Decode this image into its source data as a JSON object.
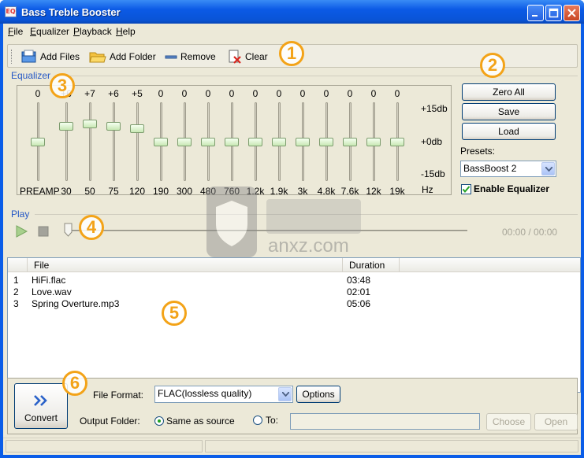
{
  "window": {
    "title": "Bass Treble Booster",
    "icon_text": "EQ"
  },
  "menu": [
    {
      "label": "File",
      "key": "F",
      "rest": "ile"
    },
    {
      "label": "Equalizer",
      "key": "E",
      "rest": "qualizer"
    },
    {
      "label": "Playback",
      "key": "P",
      "rest": "layback"
    },
    {
      "label": "Help",
      "key": "H",
      "rest": "elp"
    }
  ],
  "toolbar": {
    "add_files": "Add Files",
    "add_folder": "Add Folder",
    "remove": "Remove",
    "clear": "Clear"
  },
  "callouts": [
    "1",
    "2",
    "3",
    "4",
    "5",
    "6"
  ],
  "equalizer": {
    "group_label": "Equalizer",
    "bands": [
      {
        "label": "PREAMP",
        "value": "0",
        "level": 0
      },
      {
        "label": "30",
        "value": "+6",
        "level": 6
      },
      {
        "label": "50",
        "value": "+7",
        "level": 7
      },
      {
        "label": "75",
        "value": "+6",
        "level": 6
      },
      {
        "label": "120",
        "value": "+5",
        "level": 5
      },
      {
        "label": "190",
        "value": "0",
        "level": 0
      },
      {
        "label": "300",
        "value": "0",
        "level": 0
      },
      {
        "label": "480",
        "value": "0",
        "level": 0
      },
      {
        "label": "760",
        "value": "0",
        "level": 0
      },
      {
        "label": "1.2k",
        "value": "0",
        "level": 0
      },
      {
        "label": "1.9k",
        "value": "0",
        "level": 0
      },
      {
        "label": "3k",
        "value": "0",
        "level": 0
      },
      {
        "label": "4.8k",
        "value": "0",
        "level": 0
      },
      {
        "label": "7.6k",
        "value": "0",
        "level": 0
      },
      {
        "label": "12k",
        "value": "0",
        "level": 0
      },
      {
        "label": "19k",
        "value": "0",
        "level": 0
      }
    ],
    "scale_max": "+15db",
    "scale_mid": "+0db",
    "scale_min": "-15db",
    "unit": "Hz",
    "zero_all": "Zero All",
    "save": "Save",
    "load": "Load",
    "presets_label": "Presets:",
    "preset_value": "BassBoost 2",
    "enable_label": "Enable Equalizer",
    "enabled": true
  },
  "play": {
    "group_label": "Play",
    "time": "00:00 / 00:00",
    "progress": 0
  },
  "filelist": {
    "col_file": "File",
    "col_duration": "Duration",
    "rows": [
      {
        "num": "1",
        "name": "HiFi.flac",
        "duration": "03:48"
      },
      {
        "num": "2",
        "name": "Love.wav",
        "duration": "02:01"
      },
      {
        "num": "3",
        "name": "Spring Overture.mp3",
        "duration": "05:06"
      }
    ]
  },
  "convert": {
    "button_label": "Convert",
    "format_label": "File Format:",
    "format_value": "FLAC(lossless quality)",
    "options": "Options",
    "output_label": "Output Folder:",
    "same_as_source": "Same as source",
    "to_label": "To:",
    "choose": "Choose",
    "open": "Open"
  },
  "watermark": {
    "text": "anxz.com"
  },
  "colors": {
    "accent": "#f3a318",
    "group_label": "#2457c5",
    "titlebar": "#0b5ae6"
  }
}
